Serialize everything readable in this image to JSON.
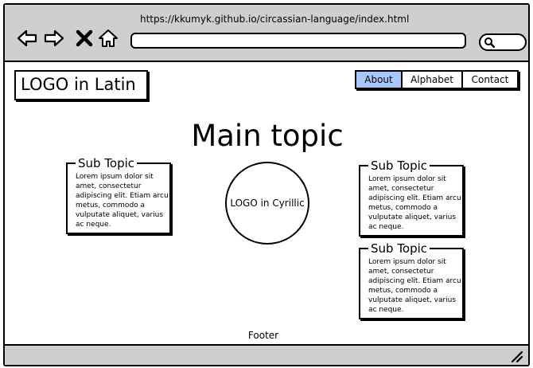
{
  "browser": {
    "url": "https://kkumyk.github.io/circassian-language/index.html",
    "icons": [
      "back-arrow-icon",
      "forward-arrow-icon",
      "close-icon",
      "home-icon",
      "search-icon",
      "resize-grip-icon"
    ]
  },
  "header": {
    "logo_latin": "LOGO in Latin",
    "nav": [
      {
        "label": "About",
        "active": true
      },
      {
        "label": "Alphabet",
        "active": false
      },
      {
        "label": "Contact",
        "active": false
      }
    ]
  },
  "main": {
    "title": "Main topic",
    "logo_cyrillic": "LOGO in Cyrillic",
    "subtopics": [
      {
        "title": "Sub Topic",
        "text": "Lorem ipsum dolor sit amet, consectetur adipiscing elit. Etiam arcu metus, commodo a vulputate aliquet, varius ac neque."
      },
      {
        "title": "Sub Topic",
        "text": "Lorem ipsum dolor sit amet, consectetur adipiscing elit. Etiam arcu metus, commodo a vulputate aliquet, varius ac neque."
      },
      {
        "title": "Sub Topic",
        "text": "Lorem ipsum dolor sit amet, consectetur adipiscing elit. Etiam arcu metus, commodo a vulputate aliquet, varius ac neque."
      }
    ]
  },
  "footer": {
    "text": "Footer"
  },
  "colors": {
    "chrome": "#cfcfcf",
    "active_nav": "#a8c8ff"
  }
}
